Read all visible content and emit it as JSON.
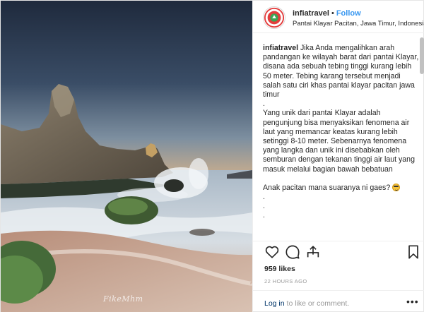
{
  "photo": {
    "signature": "FikeMhm"
  },
  "header": {
    "username": "infiatravel",
    "separator": "•",
    "follow_label": "Follow",
    "location": "Pantai Klayar Pacitan, Jawa Timur, Indonesia"
  },
  "caption": {
    "username": "infiatravel",
    "paragraph1": "Jika Anda mengalihkan arah  pandangan ke wilayah barat dari pantai Klayar, disana ada sebuah tebing tinggi kurang lebih 50 meter. Tebing karang tersebut menjadi salah satu ciri khas pantai klayar pacitan jawa timur",
    "dot1": ".",
    "paragraph2": "Yang unik dari pantai Klayar adalah pengunjung bisa menyaksikan fenomena air laut yang memancar keatas kurang lebih setinggi 8-10 meter. Sebenarnya fenomena yang langka dan unik  ini disebabkan oleh semburan dengan tekanan tinggi  air laut yang masuk melalui bagian bawah bebatuan",
    "dot2": ".",
    "question": "Anak pacitan mana suaranya ni gaes?",
    "dot3": ".",
    "dot4": ".",
    "dot5": "."
  },
  "actions": {
    "like_icon": "heart-icon",
    "comment_icon": "comment-icon",
    "share_icon": "share-icon",
    "save_icon": "bookmark-icon"
  },
  "likes": "959 likes",
  "time": "22 HOURS AGO",
  "footer": {
    "login_link": "Log in",
    "login_rest": " to like or comment.",
    "more": "•••"
  }
}
